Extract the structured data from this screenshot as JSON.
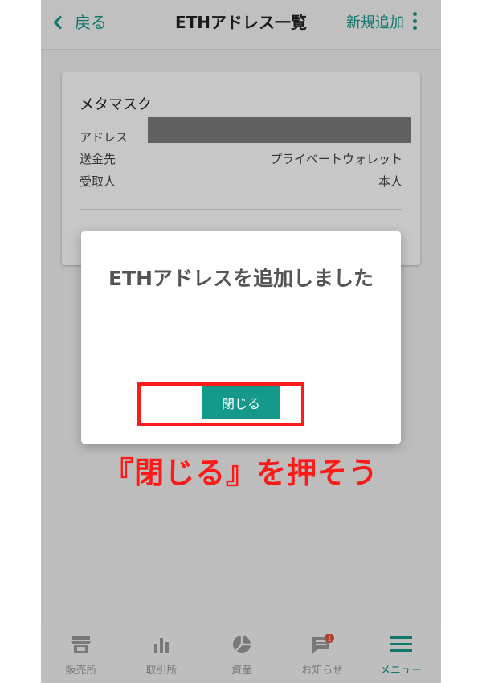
{
  "header": {
    "back_label": "戻る",
    "title": "ETHアドレス一覧",
    "add_label": "新規追加"
  },
  "card": {
    "name": "メタマスク",
    "address_label": "アドレス",
    "destination_label": "送金先",
    "destination_value": "プライベートウォレット",
    "recipient_label": "受取人",
    "recipient_value": "本人"
  },
  "dialog": {
    "message": "ETHアドレスを追加しました",
    "close_label": "閉じる"
  },
  "annotation": {
    "text": "『閉じる』を押そう",
    "color": "#ff1a1a"
  },
  "tabbar": {
    "items": [
      {
        "label": "販売所",
        "icon": "store-icon"
      },
      {
        "label": "取引所",
        "icon": "bar-chart-icon"
      },
      {
        "label": "資産",
        "icon": "pie-chart-icon"
      },
      {
        "label": "お知らせ",
        "icon": "message-icon",
        "badge": "1"
      },
      {
        "label": "メニュー",
        "icon": "menu-icon",
        "active": true
      }
    ]
  },
  "colors": {
    "accent": "#14998a",
    "badge": "#e0553c"
  }
}
